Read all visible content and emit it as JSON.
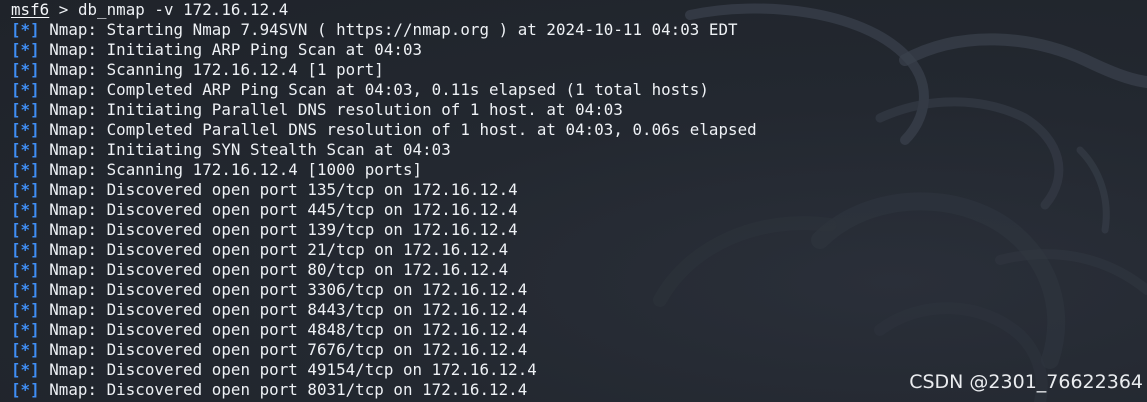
{
  "terminal": {
    "prompt": {
      "name": "msf6",
      "separator": " > ",
      "command": "db_nmap -v 172.16.12.4"
    },
    "tag": "[*]",
    "lines": [
      "Nmap: Starting Nmap 7.94SVN ( https://nmap.org ) at 2024-10-11 04:03 EDT",
      "Nmap: Initiating ARP Ping Scan at 04:03",
      "Nmap: Scanning 172.16.12.4 [1 port]",
      "Nmap: Completed ARP Ping Scan at 04:03, 0.11s elapsed (1 total hosts)",
      "Nmap: Initiating Parallel DNS resolution of 1 host. at 04:03",
      "Nmap: Completed Parallel DNS resolution of 1 host. at 04:03, 0.06s elapsed",
      "Nmap: Initiating SYN Stealth Scan at 04:03",
      "Nmap: Scanning 172.16.12.4 [1000 ports]",
      "Nmap: Discovered open port 135/tcp on 172.16.12.4",
      "Nmap: Discovered open port 445/tcp on 172.16.12.4",
      "Nmap: Discovered open port 139/tcp on 172.16.12.4",
      "Nmap: Discovered open port 21/tcp on 172.16.12.4",
      "Nmap: Discovered open port 80/tcp on 172.16.12.4",
      "Nmap: Discovered open port 3306/tcp on 172.16.12.4",
      "Nmap: Discovered open port 8443/tcp on 172.16.12.4",
      "Nmap: Discovered open port 4848/tcp on 172.16.12.4",
      "Nmap: Discovered open port 7676/tcp on 172.16.12.4",
      "Nmap: Discovered open port 49154/tcp on 172.16.12.4",
      "Nmap: Discovered open port 8031/tcp on 172.16.12.4"
    ]
  },
  "watermark": "CSDN @2301_76622364",
  "colors": {
    "background": "#21252c",
    "text": "#eef1f5",
    "tag": "#3f8ef5"
  }
}
